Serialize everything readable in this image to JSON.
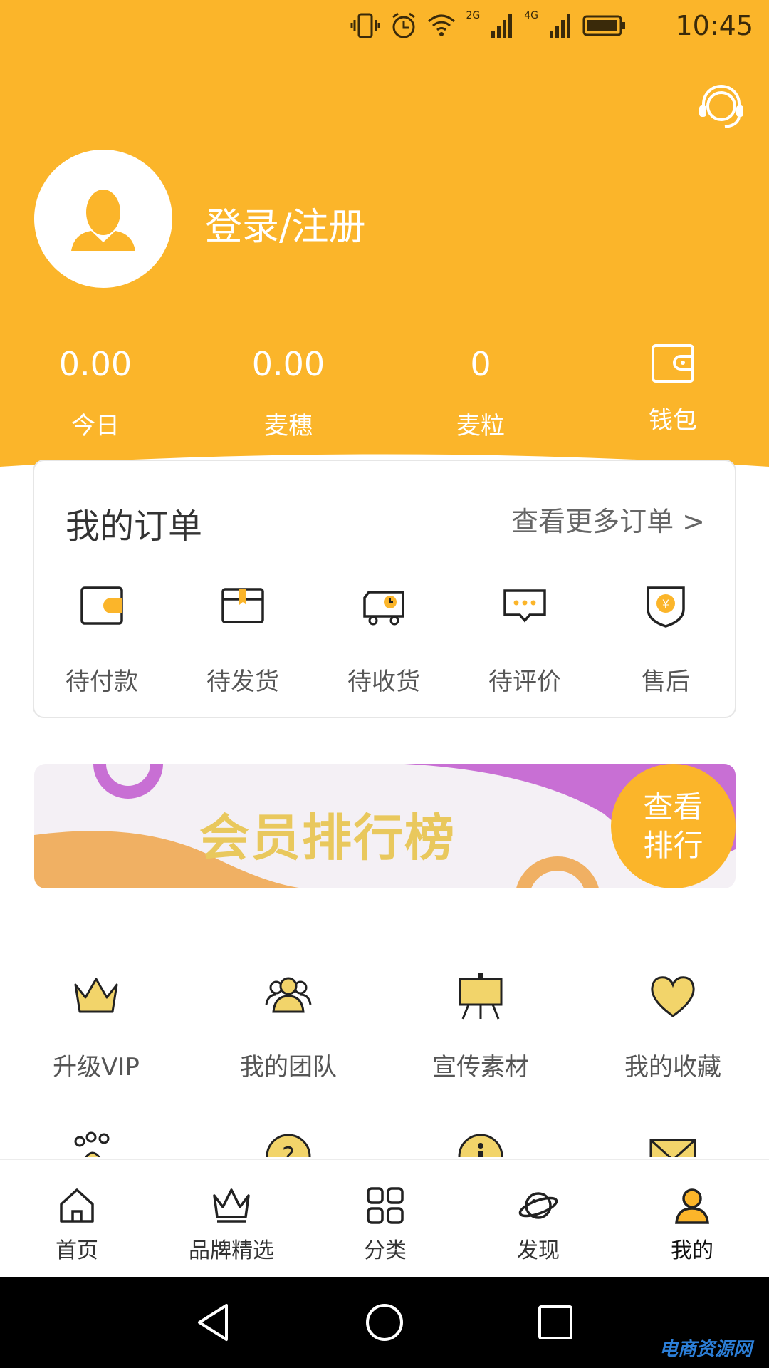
{
  "colors": {
    "accent": "#fbb52a",
    "white": "#ffffff",
    "text": "#333333"
  },
  "status_bar": {
    "time": "10:45",
    "network_1": "2G",
    "network_2": "4G"
  },
  "header": {
    "login_text": "登录/注册"
  },
  "stats": [
    {
      "value": "0.00",
      "label": "今日"
    },
    {
      "value": "0.00",
      "label": "麦穗"
    },
    {
      "value": "0",
      "label": "麦粒"
    },
    {
      "value": "",
      "label": "钱包",
      "icon": "wallet-icon"
    }
  ],
  "orders": {
    "title": "我的订单",
    "more": "查看更多订单 >",
    "items": [
      {
        "label": "待付款",
        "icon": "wallet-icon"
      },
      {
        "label": "待发货",
        "icon": "package-icon"
      },
      {
        "label": "待收货",
        "icon": "delivery-truck-icon"
      },
      {
        "label": "待评价",
        "icon": "comment-icon"
      },
      {
        "label": "售后",
        "icon": "shield-yen-icon"
      }
    ]
  },
  "banner": {
    "title": "会员排行榜",
    "button_line1": "查看",
    "button_line2": "排行"
  },
  "tools": [
    {
      "label": "升级VIP",
      "icon": "crown-icon"
    },
    {
      "label": "我的团队",
      "icon": "team-icon"
    },
    {
      "label": "宣传素材",
      "icon": "easel-icon"
    },
    {
      "label": "我的收藏",
      "icon": "heart-icon"
    }
  ],
  "tools_row2": [
    {
      "icon": "paw-icon"
    },
    {
      "icon": "help-icon"
    },
    {
      "icon": "info-icon"
    },
    {
      "icon": "mail-icon"
    }
  ],
  "tabbar": [
    {
      "label": "首页",
      "icon": "home-icon"
    },
    {
      "label": "品牌精选",
      "icon": "crown-outline-icon"
    },
    {
      "label": "分类",
      "icon": "grid-icon"
    },
    {
      "label": "发现",
      "icon": "planet-icon"
    },
    {
      "label": "我的",
      "icon": "user-icon",
      "active": true
    }
  ],
  "watermark": "电商资源网"
}
